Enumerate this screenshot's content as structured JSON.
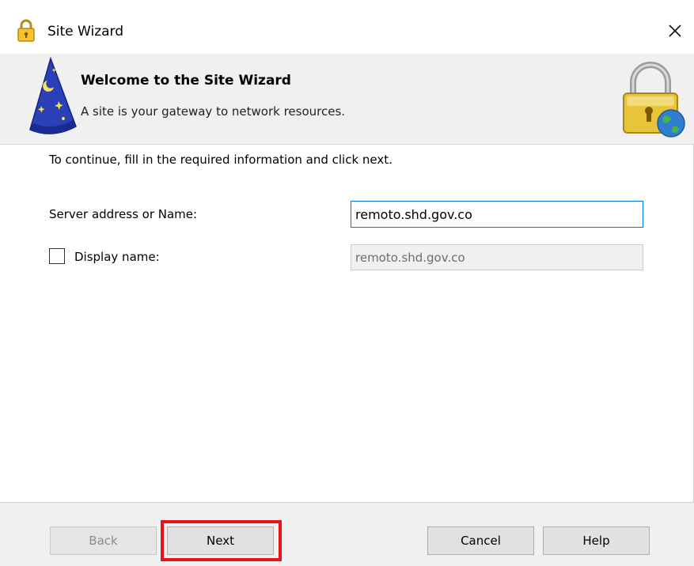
{
  "window": {
    "title": "Site Wizard",
    "close_glyph": "✕"
  },
  "banner": {
    "title": "Welcome to the Site Wizard",
    "subtitle": "A site is your gateway to network resources."
  },
  "form": {
    "instruction": "To continue, fill in the required information and click next.",
    "server_label": "Server address or Name:",
    "server_value": "remoto.shd.gov.co",
    "display_label": "Display name:",
    "display_checked": false,
    "display_value": "remoto.shd.gov.co"
  },
  "footer": {
    "back_label": "Back",
    "next_label": "Next",
    "cancel_label": "Cancel",
    "help_label": "Help"
  },
  "colors": {
    "focus_border": "#0078d7",
    "highlight": "#e8141b",
    "panel": "#f0f0f0"
  },
  "icons": {
    "title": "padlock-icon",
    "banner_left": "wizard-hat-icon",
    "banner_right": "lock-globe-icon"
  }
}
